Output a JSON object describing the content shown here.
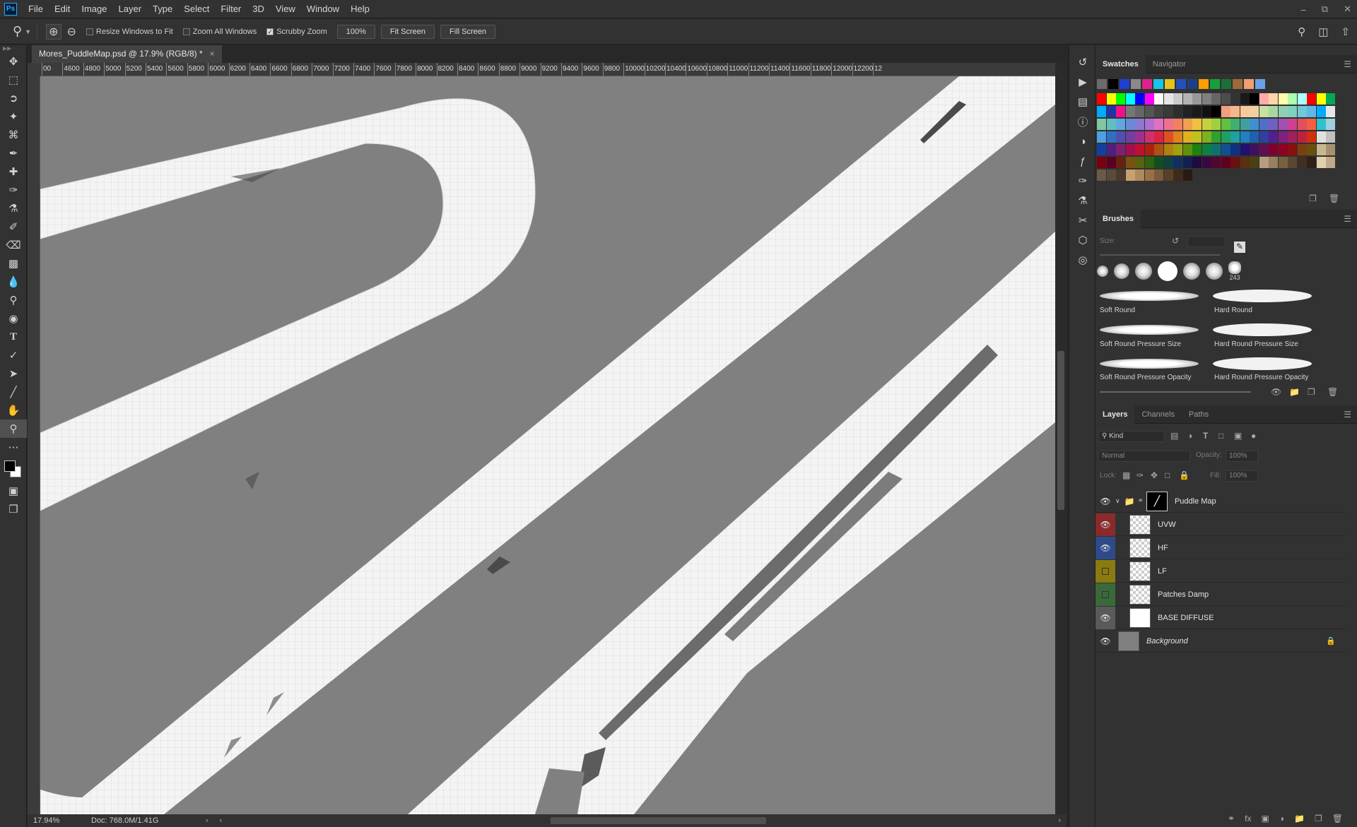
{
  "menu": {
    "logo": "Ps",
    "items": [
      "File",
      "Edit",
      "Image",
      "Layer",
      "Type",
      "Select",
      "Filter",
      "3D",
      "View",
      "Window",
      "Help"
    ]
  },
  "options": {
    "resize_windows": "Resize Windows to Fit",
    "resize_checked": false,
    "zoom_all": "Zoom All Windows",
    "zoom_all_checked": false,
    "scrubby": "Scrubby Zoom",
    "scrubby_checked": true,
    "zoom_value": "100%",
    "fit_screen": "Fit Screen",
    "fill_screen": "Fill Screen"
  },
  "document": {
    "tab_title": "Mores_PuddleMap.psd @ 17.9% (RGB/8) *",
    "close": "×",
    "zoom": "17.94%",
    "doc_info": "Doc: 768.0M/1.41G"
  },
  "ruler": {
    "labels": [
      "00",
      "4600",
      "4800",
      "5000",
      "5200",
      "5400",
      "5600",
      "5800",
      "6000",
      "6200",
      "6400",
      "6600",
      "6800",
      "7000",
      "7200",
      "7400",
      "7600",
      "7800",
      "8000",
      "8200",
      "8400",
      "8600",
      "8800",
      "9000",
      "9200",
      "9400",
      "9600",
      "9800",
      "10000",
      "10200",
      "10400",
      "10600",
      "10800",
      "11000",
      "11200",
      "11400",
      "11600",
      "11800",
      "12000",
      "12200",
      "12"
    ]
  },
  "tools": [
    "move-tool",
    "marquee-tool",
    "lasso-tool",
    "magic-wand-tool",
    "crop-tool",
    "eyedropper-tool",
    "healing-tool",
    "brush-tool",
    "clone-stamp-tool",
    "history-brush-tool",
    "eraser-tool",
    "gradient-tool",
    "blur-tool",
    "dodge-tool",
    "sponge-tool",
    "type-tool",
    "pen-tool",
    "path-select-tool",
    "line-tool",
    "hand-tool",
    "zoom-tool",
    "more-tools"
  ],
  "swatches": {
    "tabs": [
      "Swatches",
      "Navigator"
    ],
    "recent": [
      "#6b6b6b",
      "#000000",
      "#1f3ed6",
      "#8a8a8a",
      "#e0218a",
      "#17c4ea",
      "#e6c21a",
      "#2550b8",
      "#1c3f8a",
      "#ff9d00",
      "#1a9e3a",
      "#1e6e3a",
      "#9a6a3a",
      "#f0a070",
      "#6aa0e8"
    ],
    "rows": [
      [
        "#ff0000",
        "#ffff00",
        "#00ff00",
        "#00ffff",
        "#0000ff",
        "#ff00ff",
        "#ffffff",
        "#e6e6e6",
        "#cccccc",
        "#b3b3b3",
        "#999999",
        "#808080",
        "#666666",
        "#4d4d4d",
        "#333333",
        "#1a1a1a",
        "#000000",
        "#ffaaaa",
        "#ffd4aa",
        "#ffffaa",
        "#aaffaa",
        "#aaffff",
        "#ff0000",
        "#ffff00",
        "#00aa55"
      ],
      [
        "#00aaff",
        "#2233aa",
        "#ee1188",
        "#777777",
        "#666666",
        "#555555",
        "#444444",
        "#3a3a3a",
        "#2e2e2e",
        "#222222",
        "#1a1a1a",
        "#111111",
        "#000000",
        "#f0a080",
        "#f5b88a",
        "#f7c99b",
        "#f0d0a0",
        "#c8e0a0",
        "#a8d8a0",
        "#90d0b0",
        "#80d0c0",
        "#70c8d8",
        "#60b8e8",
        "#00aaff",
        "#e6e6e6"
      ],
      [
        "#80c8a0",
        "#60c0c0",
        "#60a8e0",
        "#6a8ad8",
        "#8a7ad0",
        "#b070d0",
        "#e070c0",
        "#f07090",
        "#f08060",
        "#f0a050",
        "#f0c040",
        "#c8d040",
        "#a0d040",
        "#60c040",
        "#40b070",
        "#40a0a0",
        "#4090d0",
        "#5070c8",
        "#7060c0",
        "#a050b0",
        "#d04090",
        "#e05060",
        "#f06040",
        "#30c0d0",
        "#a0d0e0"
      ],
      [
        "#4fa0e0",
        "#3070c0",
        "#5050b0",
        "#7040a0",
        "#a03090",
        "#d03070",
        "#e02040",
        "#e05020",
        "#e08020",
        "#e0b020",
        "#c0c020",
        "#80b020",
        "#30a030",
        "#20a060",
        "#20a0a0",
        "#2080c0",
        "#2060b0",
        "#3040a0",
        "#502090",
        "#802080",
        "#a02060",
        "#c02040",
        "#d03010",
        "#e0e0e0",
        "#c0c0c0"
      ],
      [
        "#1040a0",
        "#502080",
        "#802070",
        "#a01050",
        "#c01030",
        "#b02010",
        "#b05010",
        "#b08010",
        "#a0a010",
        "#60900a",
        "#208010",
        "#108040",
        "#107070",
        "#105090",
        "#103080",
        "#201070",
        "#401060",
        "#601050",
        "#800030",
        "#900020",
        "#8a1010",
        "#7a4010",
        "#6a5010",
        "#c8b890",
        "#a89070"
      ],
      [
        "#7a0010",
        "#5a0020",
        "#6a2010",
        "#7a5010",
        "#5a6010",
        "#306010",
        "#105020",
        "#104040",
        "#103060",
        "#102050",
        "#200a40",
        "#3a0840",
        "#500830",
        "#600020",
        "#6a1010",
        "#5a3010",
        "#4a4010",
        "#b89c80",
        "#988060",
        "#786040",
        "#5a4830",
        "#403020",
        "#302018",
        "#e0d0b0",
        "#c0a888"
      ],
      [
        "#6a5a4a",
        "#5a4a3a",
        "#4a3a2a",
        "#c8a070",
        "#b08a5a",
        "#987048",
        "#7a5a38",
        "#5a4028",
        "#402a18",
        "#2a1a10"
      ]
    ]
  },
  "brushes": {
    "title": "Brushes",
    "size_label": "Size:",
    "count": "243",
    "items": [
      {
        "name": "Soft Round"
      },
      {
        "name": "Hard Round"
      },
      {
        "name": "Soft Round Pressure Size"
      },
      {
        "name": "Hard Round Pressure Size"
      },
      {
        "name": "Soft Round Pressure Opacity"
      },
      {
        "name": "Hard Round Pressure Opacity"
      }
    ]
  },
  "layers": {
    "tabs": [
      "Layers",
      "Channels",
      "Paths"
    ],
    "filter_label": "Kind",
    "blend_mode": "Normal",
    "opacity_label": "Opacity:",
    "opacity": "100%",
    "lock_label": "Lock:",
    "fill_label": "Fill:",
    "fill": "100%",
    "rows": [
      {
        "name": "Puddle Map",
        "color": "#323232",
        "visible": true,
        "group": true
      },
      {
        "name": "UVW",
        "color": "#8a2a2a",
        "visible": true
      },
      {
        "name": "HF",
        "color": "#2e4a8a",
        "visible": true
      },
      {
        "name": "LF",
        "color": "#8a7a10",
        "visible": false
      },
      {
        "name": "Patches Damp",
        "color": "#3a6a3a",
        "visible": false
      },
      {
        "name": "BASE DIFFUSE",
        "color": "#5a5a5a",
        "visible": true
      },
      {
        "name": "Background",
        "color": "#323232",
        "visible": true,
        "locked": true
      }
    ]
  },
  "colors": {
    "canvas": "#808080",
    "accent": "#31a8ff",
    "panel": "#323232"
  }
}
